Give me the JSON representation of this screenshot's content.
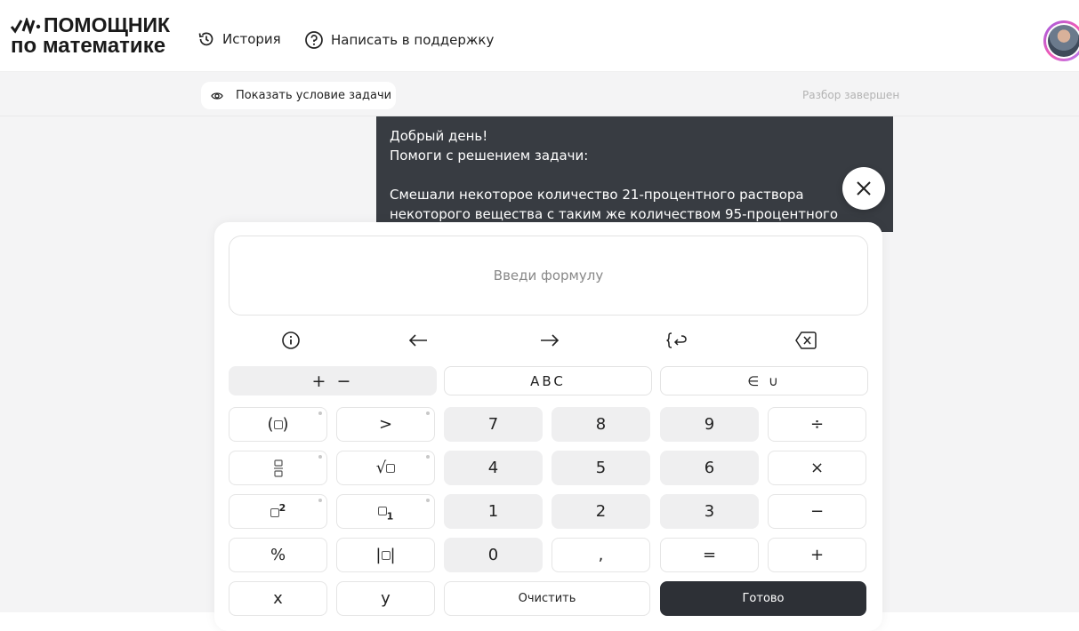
{
  "header": {
    "logo_line1": "ПОМОЩНИК",
    "logo_line2": "по математике",
    "nav_history": "История",
    "nav_support": "Написать в поддержку"
  },
  "toolbar": {
    "show_condition": "Показать условие задачи",
    "status": "Разбор завершен"
  },
  "message": {
    "line1": "Добрый день!",
    "line2": "Помоги с решением задачи:",
    "line3": "Смешали некоторое количество 21-процентного раствора",
    "line4": "некоторого вещества с таким же количеством 95-процентного"
  },
  "keyboard": {
    "formula_placeholder": "Введи формулу",
    "tabs": [
      "+ −",
      "ABC",
      "∈ ∪"
    ],
    "keys": {
      "gt": ">",
      "k7": "7",
      "k8": "8",
      "k9": "9",
      "div": "÷",
      "k4": "4",
      "k5": "5",
      "k6": "6",
      "mul": "×",
      "k1": "1",
      "k2": "2",
      "k3": "3",
      "minus": "−",
      "percent": "%",
      "k0": "0",
      "comma": ",",
      "eq": "=",
      "plus": "+",
      "x": "x",
      "y": "y",
      "clear": "Очистить",
      "done": "Готово"
    }
  },
  "colors": {
    "dark": "#2d3036",
    "message_bg": "#383c42",
    "panel_gray": "#f4f4f5"
  }
}
